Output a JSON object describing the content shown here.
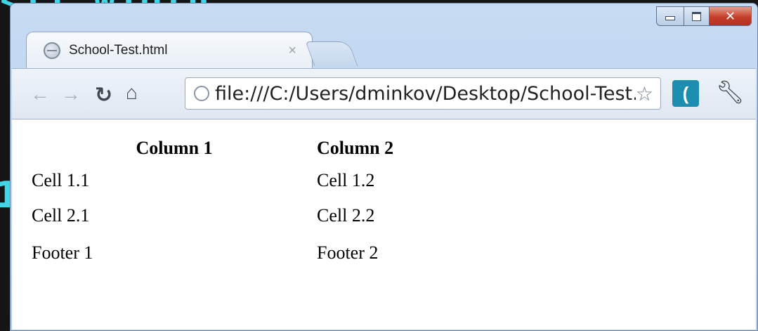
{
  "tab": {
    "title": "School-Test.html",
    "close": "×"
  },
  "toolbar": {
    "url": "file:///C:/Users/dminkov/Desktop/School-Test.html"
  },
  "table": {
    "headers": [
      "Column 1",
      "Column 2"
    ],
    "rows": [
      [
        "Cell 1.1",
        "Cell 1.2"
      ],
      [
        "Cell 2.1",
        "Cell 2.2"
      ]
    ],
    "footer": [
      "Footer 1",
      "Footer 2"
    ]
  },
  "icons": [
    "back-icon",
    "forward-icon",
    "reload-icon",
    "home-icon",
    "page-icon",
    "star-icon",
    "extension-icon",
    "wrench-icon"
  ],
  "colors": {
    "titlebar": "#b2cdec",
    "close_button": "#c43e2a",
    "slide_text": "#41d6e6"
  }
}
